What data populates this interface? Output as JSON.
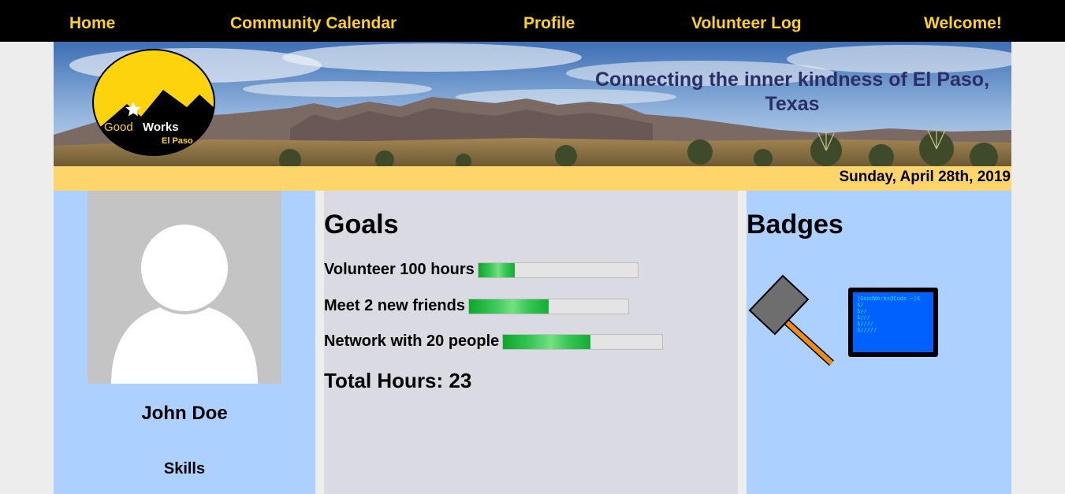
{
  "nav": {
    "home": "Home",
    "calendar": "Community Calendar",
    "profile": "Profile",
    "volunteer_log": "Volunteer Log",
    "welcome": "Welcome!"
  },
  "header": {
    "tagline": "Connecting the inner kindness of El Paso, Texas",
    "logo": {
      "name": "Good",
      "name_bold": "Works",
      "city": "El Paso"
    },
    "date": "Sunday, April 28th, 2019"
  },
  "profile": {
    "name": "John Doe",
    "skills_heading": "Skills"
  },
  "goals": {
    "heading": "Goals",
    "items": [
      {
        "label": "Volunteer 100 hours",
        "progress": 0.23
      },
      {
        "label": "Meet 2 new friends",
        "progress": 0.5
      },
      {
        "label": "Network with 20 people",
        "progress": 0.55
      }
    ],
    "total_hours": "Total Hours: 23"
  },
  "badges": {
    "heading": "Badges",
    "items": [
      {
        "icon": "hammer-icon"
      },
      {
        "icon": "code-terminal-icon",
        "lines": [
          "[GoodWorks@Code ~]$",
          "$/",
          "$//",
          "$///",
          "$////",
          "$/////"
        ]
      }
    ]
  },
  "colors": {
    "nav_bg": "#000000",
    "nav_text": "#ffd21a",
    "date_bar": "#fed56a",
    "side_columns": "#acd0ff",
    "middle_column": "#d9dae2",
    "tagline": "#2b2f63",
    "progress_fill": "#16b034"
  }
}
